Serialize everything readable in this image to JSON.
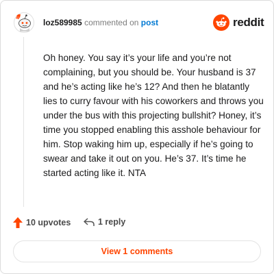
{
  "comment": {
    "username": "loz589985",
    "action_text": "commented on",
    "post_link": "post",
    "brand": "reddit",
    "body": "Oh honey. You say it’s your life and you’re not complaining, but you should be. Your husband is 37 and he’s acting like he’s 12? And then he blatantly lies to curry favour with his coworkers and throws you under the bus with this projecting bullshit? Honey, it’s time you stopped enabling this asshole behaviour for him. Stop waking him up, especially if he’s going to swear and take it out on you. He’s 37. It’s time he started acting like it. NTA"
  },
  "footer": {
    "upvotes": "10 upvotes",
    "replies": "1 reply",
    "view_comments": "View 1 comments"
  },
  "icons": {
    "avatar": "snoo-avatar-icon",
    "logo": "reddit-logo-icon",
    "upvote": "upvote-arrow-icon",
    "reply": "reply-arrow-icon"
  },
  "colors": {
    "brand_orange": "#ff4500",
    "link_blue": "#0079d3",
    "text": "#1a1a1b",
    "muted": "#7c7c7c"
  }
}
